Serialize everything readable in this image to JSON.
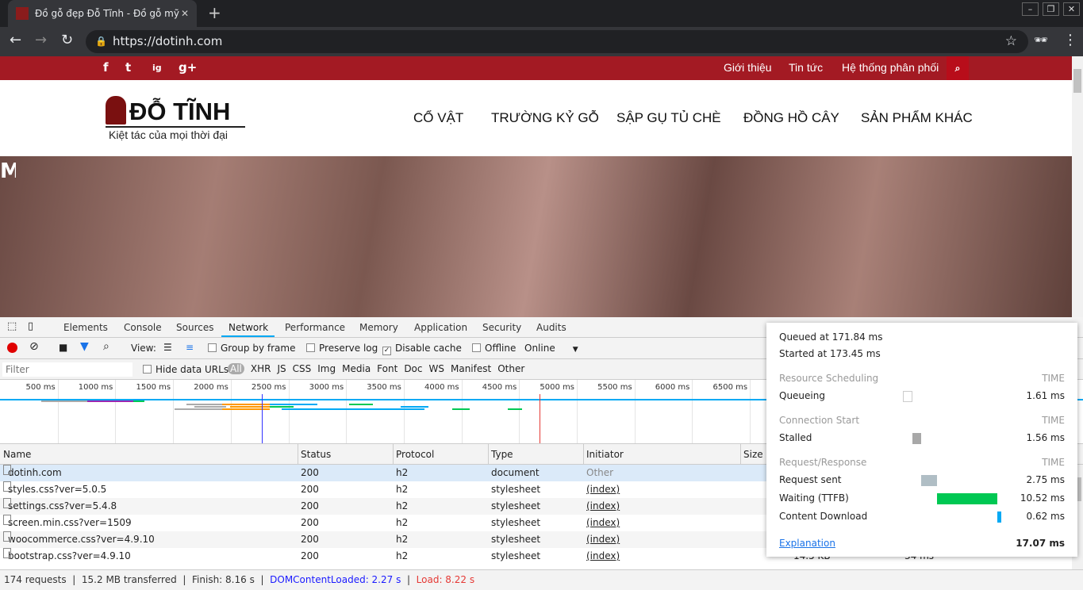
{
  "browser": {
    "tab_title": "Đồ gỗ đẹp Đỗ Tĩnh - Đồ gỗ mỹ n",
    "url": "https://dotinh.com",
    "window_controls": [
      "minimize",
      "restore",
      "close"
    ]
  },
  "site": {
    "social": [
      "f",
      "t",
      "ig",
      "g+"
    ],
    "top_links": [
      "Giới thiệu",
      "Tin tức",
      "Hệ thống phân phối"
    ],
    "logo_name": "ĐỖ TĨNH",
    "logo_tagline": "Kiệt tác của mọi thời đại",
    "nav": [
      "CỔ VẬT",
      "TRƯỜNG KỶ GỖ",
      "SẬP GỤ TỦ CHÈ",
      "ĐỒNG HỒ CÂY",
      "SẢN PHẨM KHÁC"
    ],
    "hero_text": "M"
  },
  "devtools": {
    "tabs": [
      "Elements",
      "Console",
      "Sources",
      "Network",
      "Performance",
      "Memory",
      "Application",
      "Security",
      "Audits"
    ],
    "active_tab": "Network",
    "toolbar": {
      "view_label": "View:",
      "group_by_frame": "Group by frame",
      "preserve_log": "Preserve log",
      "disable_cache": "Disable cache",
      "disable_cache_checked": true,
      "offline": "Offline",
      "throttle": "Online"
    },
    "filter": {
      "placeholder": "Filter",
      "hide_data_urls": "Hide data URLs",
      "types": [
        "All",
        "XHR",
        "JS",
        "CSS",
        "Img",
        "Media",
        "Font",
        "Doc",
        "WS",
        "Manifest",
        "Other"
      ],
      "active_type": "All"
    },
    "overview_ticks": [
      "500 ms",
      "1000 ms",
      "1500 ms",
      "2000 ms",
      "2500 ms",
      "3000 ms",
      "3500 ms",
      "4000 ms",
      "4500 ms",
      "5000 ms",
      "5500 ms",
      "6000 ms",
      "6500 ms"
    ],
    "columns": [
      "Name",
      "Status",
      "Protocol",
      "Type",
      "Initiator",
      "Size"
    ],
    "rows": [
      {
        "name": "dotinh.com",
        "status": "200",
        "protocol": "h2",
        "type": "document",
        "initiator": "Other"
      },
      {
        "name": "styles.css?ver=5.0.5",
        "status": "200",
        "protocol": "h2",
        "type": "stylesheet",
        "initiator": "(index)"
      },
      {
        "name": "settings.css?ver=5.4.8",
        "status": "200",
        "protocol": "h2",
        "type": "stylesheet",
        "initiator": "(index)"
      },
      {
        "name": "screen.min.css?ver=1509",
        "status": "200",
        "protocol": "h2",
        "type": "stylesheet",
        "initiator": "(index)"
      },
      {
        "name": "woocommerce.css?ver=4.9.10",
        "status": "200",
        "protocol": "h2",
        "type": "stylesheet",
        "initiator": "(index)"
      },
      {
        "name": "bootstrap.css?ver=4.9.10",
        "status": "200",
        "protocol": "h2",
        "type": "stylesheet",
        "initiator": "(index)",
        "size": "14.5 KB",
        "time": "34 ms"
      }
    ],
    "status_bar": {
      "requests": "174 requests",
      "transferred": "15.2 MB transferred",
      "finish": "Finish: 8.16 s",
      "dom": "DOMContentLoaded: 2.27 s",
      "load": "Load: 8.22 s"
    },
    "timing": {
      "queued": "Queued at 171.84 ms",
      "started": "Started at 173.45 ms",
      "time_label": "TIME",
      "sections": [
        {
          "title": "Resource Scheduling",
          "items": [
            {
              "label": "Queueing",
              "value": "1.61 ms",
              "color": "#ffffff"
            }
          ]
        },
        {
          "title": "Connection Start",
          "items": [
            {
              "label": "Stalled",
              "value": "1.56 ms",
              "color": "#a8a8a8"
            }
          ]
        },
        {
          "title": "Request/Response",
          "items": [
            {
              "label": "Request sent",
              "value": "2.75 ms",
              "color": "#b0bec5"
            },
            {
              "label": "Waiting (TTFB)",
              "value": "10.52 ms",
              "color": "#00c853"
            },
            {
              "label": "Content Download",
              "value": "0.62 ms",
              "color": "#03a9f4"
            }
          ]
        }
      ],
      "explanation": "Explanation",
      "total": "17.07 ms"
    },
    "colors": {
      "accent": "#1a73e8",
      "dom_line": "#3333ff",
      "load_line": "#e53935",
      "record": "#e00000"
    }
  }
}
